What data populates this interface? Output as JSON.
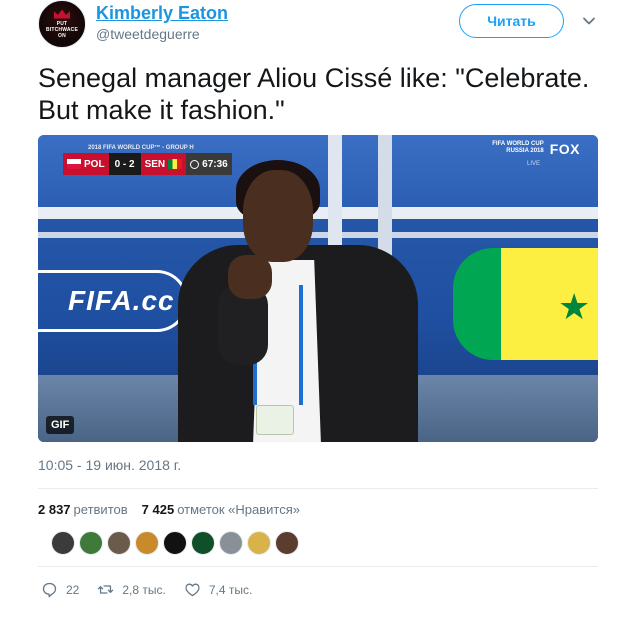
{
  "author": {
    "name": "Kimberly Eaton",
    "handle": "@tweetdeguerre",
    "avatar_lines": [
      "PUT",
      "BITCHWACE",
      "ON"
    ]
  },
  "follow_button": {
    "label": "Читать"
  },
  "more_menu": {
    "icon": "chevron-down-icon"
  },
  "tweet": {
    "text": "Senegal manager Aliou Cissé like: \"Celebrate. But make it fashion.\""
  },
  "media": {
    "gif_label": "GIF",
    "scoreboard": {
      "header": "2018 FIFA WORLD CUP™ - GROUP H",
      "home": "POL",
      "score": "0 - 2",
      "away": "SEN",
      "time": "67:36"
    },
    "broadcast": {
      "event": [
        "FIFA WORLD CUP",
        "RUSSIA 2018"
      ],
      "network": "FOX",
      "live": "LIVE"
    },
    "banner_text": "FIFA.cc",
    "colors": {
      "sky": "#2a5db0",
      "senegal_green": "#00a651",
      "senegal_yellow": "#fdef42"
    }
  },
  "timestamp": "10:05 - 19 июн. 2018 г.",
  "stats": {
    "retweets_count": "2 837",
    "retweets_label": "ретвитов",
    "likes_count": "7 425",
    "likes_label": "отметок «Нравится»"
  },
  "likers_colors": [
    "#3b3b3b",
    "#3f7a3a",
    "#6b5b4b",
    "#c88a2a",
    "#111111",
    "#0f4f2a",
    "#8a9098",
    "#d9b24a",
    "#5a3d2e"
  ],
  "actions": {
    "reply_count": "22",
    "retweet_count": "2,8 тыс.",
    "like_count": "7,4 тыс."
  },
  "accent_color": "#1da1f2"
}
